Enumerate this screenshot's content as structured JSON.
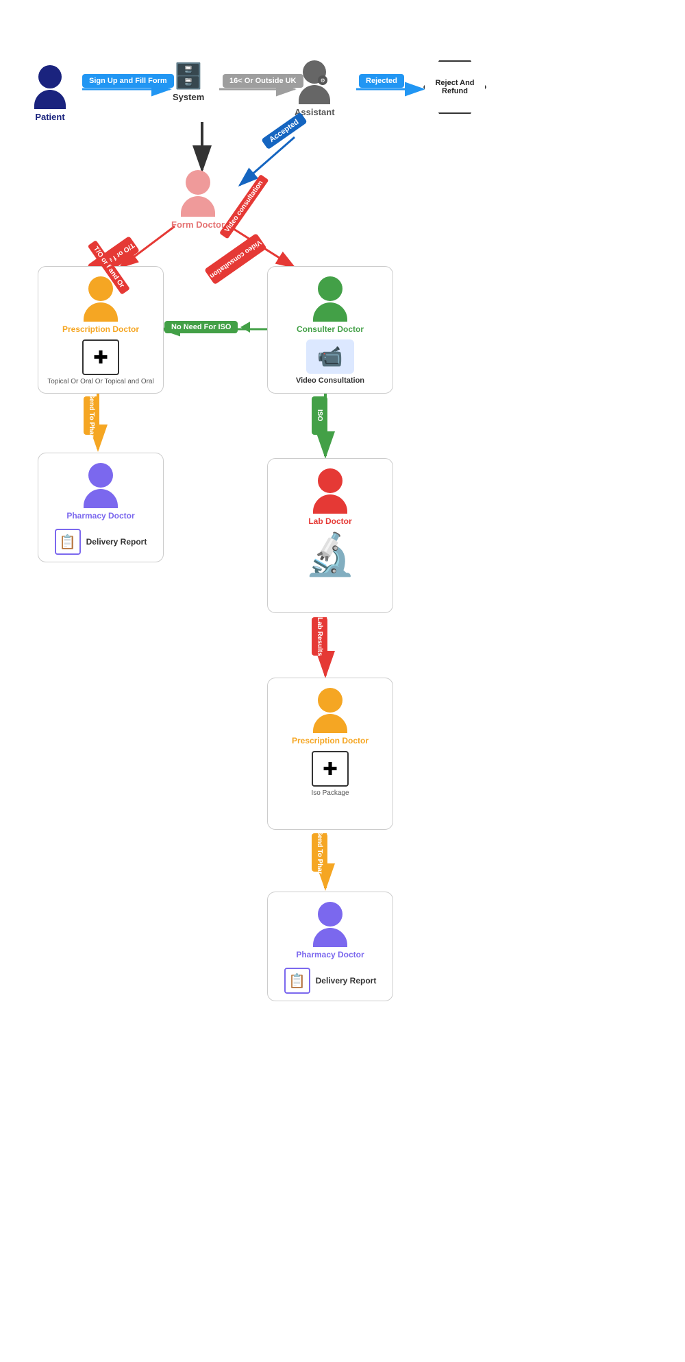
{
  "nodes": {
    "patient": {
      "label": "Patient",
      "color": "#1a237e"
    },
    "system": {
      "label": "System",
      "color": "#333"
    },
    "assistant": {
      "label": "Assistant",
      "color": "#555"
    },
    "rejectRefund": {
      "label": "Reject And Refund"
    },
    "formDoctor": {
      "label": "Form Doctor",
      "color": "#e57373"
    },
    "prescriptionDoctor1": {
      "label": "Prescription Doctor",
      "color": "#f5a623"
    },
    "consulterDoctor": {
      "label": "Consulter Doctor",
      "color": "#43a047"
    },
    "videoConsultation": {
      "label": "Video Consultation"
    },
    "pharmacyDoctor1": {
      "label": "Pharmacy Doctor",
      "color": "#7b68ee"
    },
    "deliveryReport1": {
      "label": "Delivery Report",
      "color": "#7b68ee"
    },
    "labDoctor": {
      "label": "Lab Doctor",
      "color": "#e53935"
    },
    "prescriptionDoctor2": {
      "label": "Prescription Doctor",
      "color": "#f5a623"
    },
    "isoPackage": {
      "label": "Iso Package"
    },
    "pharmacyDoctor2": {
      "label": "Pharmacy Doctor",
      "color": "#7b68ee"
    },
    "deliveryReport2": {
      "label": "Delivery Report",
      "color": "#7b68ee"
    }
  },
  "arrows": {
    "signUpFillForm": {
      "label": "Sign Up and Fill Form",
      "color": "#2196F3"
    },
    "outsideUK": {
      "label": "16< Or Outside UK",
      "color": "#9e9e9e"
    },
    "rejected": {
      "label": "Rejected",
      "color": "#2196F3"
    },
    "accepted": {
      "label": "Accepted",
      "color": "#1565c0"
    },
    "toOrfAndOr": {
      "label": "T/O or f and Or",
      "color": "#e53935"
    },
    "videoConsultation": {
      "label": "Video consultation",
      "color": "#e53935"
    },
    "noNeedForISO": {
      "label": "No Need For ISO",
      "color": "#43a047"
    },
    "sendToPhar1": {
      "label": "Send To Phar",
      "color": "#f5a623"
    },
    "iso": {
      "label": "ISO",
      "color": "#43a047"
    },
    "labResults": {
      "label": "Lab Results",
      "color": "#e53935"
    },
    "sendToPhar2": {
      "label": "Send To Phar",
      "color": "#f5a623"
    }
  },
  "topItems": {
    "topicalOrOral": "Topical Or Oral Or Topical and Oral",
    "isoPackage": "Iso Package"
  }
}
